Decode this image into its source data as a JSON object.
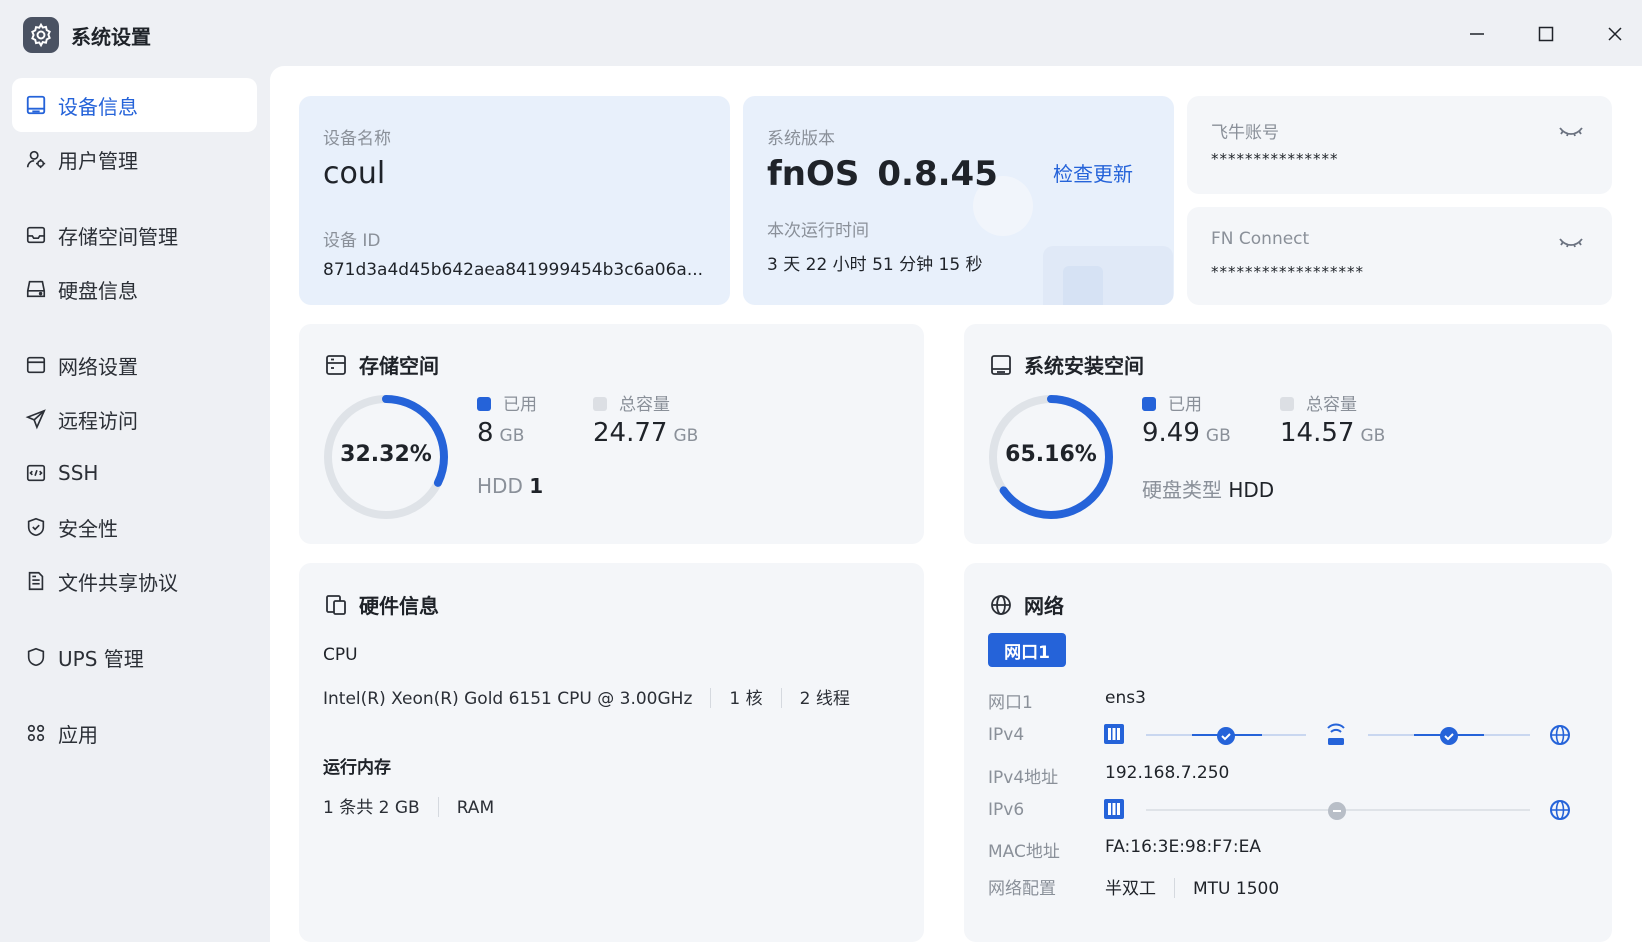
{
  "app": {
    "title": "系统设置"
  },
  "sidebar": {
    "items": [
      {
        "label": "设备信息",
        "icon": "device-icon"
      },
      {
        "label": "用户管理",
        "icon": "user-icon"
      },
      {
        "label": "存储空间管理",
        "icon": "storage-icon"
      },
      {
        "label": "硬盘信息",
        "icon": "disk-icon"
      },
      {
        "label": "网络设置",
        "icon": "network-settings-icon"
      },
      {
        "label": "远程访问",
        "icon": "remote-access-icon"
      },
      {
        "label": "SSH",
        "icon": "ssh-icon"
      },
      {
        "label": "安全性",
        "icon": "shield-icon"
      },
      {
        "label": "文件共享协议",
        "icon": "file-share-icon"
      },
      {
        "label": "UPS 管理",
        "icon": "ups-icon"
      },
      {
        "label": "应用",
        "icon": "apps-icon"
      }
    ]
  },
  "device": {
    "name_label": "设备名称",
    "name": "coul",
    "id_label": "设备 ID",
    "id": "871d3a4d45b642aea841999454b3c6a06a..."
  },
  "system": {
    "version_label": "系统版本",
    "os": "fnOS",
    "version": "0.8.45",
    "check_update": "检查更新",
    "uptime_label": "本次运行时间",
    "uptime": "3 天 22 小时 51 分钟 15 秒"
  },
  "account": {
    "label": "飞牛账号",
    "value": "***************"
  },
  "fn_connect": {
    "label": "FN Connect",
    "value": "******************"
  },
  "storage": {
    "title": "存储空间",
    "percent": "32.32%",
    "used_fraction": 0.3232,
    "used_label": "已用",
    "used_value": "8",
    "used_unit": "GB",
    "total_label": "总容量",
    "total_value": "24.77",
    "total_unit": "GB",
    "disk_type": "HDD",
    "disk_count": "1"
  },
  "system_space": {
    "title": "系统安装空间",
    "percent": "65.16%",
    "used_fraction": 0.6516,
    "used_label": "已用",
    "used_value": "9.49",
    "used_unit": "GB",
    "total_label": "总容量",
    "total_value": "14.57",
    "total_unit": "GB",
    "disk_type_label": "硬盘类型",
    "disk_type": "HDD"
  },
  "hardware": {
    "title": "硬件信息",
    "cpu_label": "CPU",
    "cpu_model": "Intel(R) Xeon(R) Gold 6151 CPU @ 3.00GHz",
    "cpu_cores": "1 核",
    "cpu_threads": "2 线程",
    "mem_label": "运行内存",
    "mem_size": "1 条共 2 GB",
    "mem_type": "RAM"
  },
  "network": {
    "title": "网络",
    "tab": "网口1",
    "port_label": "网口1",
    "port_value": "ens3",
    "ipv4_label": "IPv4",
    "ipv4_addr_label": "IPv4地址",
    "ipv4_addr": "192.168.7.250",
    "ipv6_label": "IPv6",
    "mac_label": "MAC地址",
    "mac": "FA:16:3E:98:F7:EA",
    "config_label": "网络配置",
    "duplex": "半双工",
    "mtu": "MTU 1500"
  },
  "colors": {
    "accent": "#2563d9",
    "ring_track": "#dfe3e8",
    "muted": "#8a9099"
  }
}
